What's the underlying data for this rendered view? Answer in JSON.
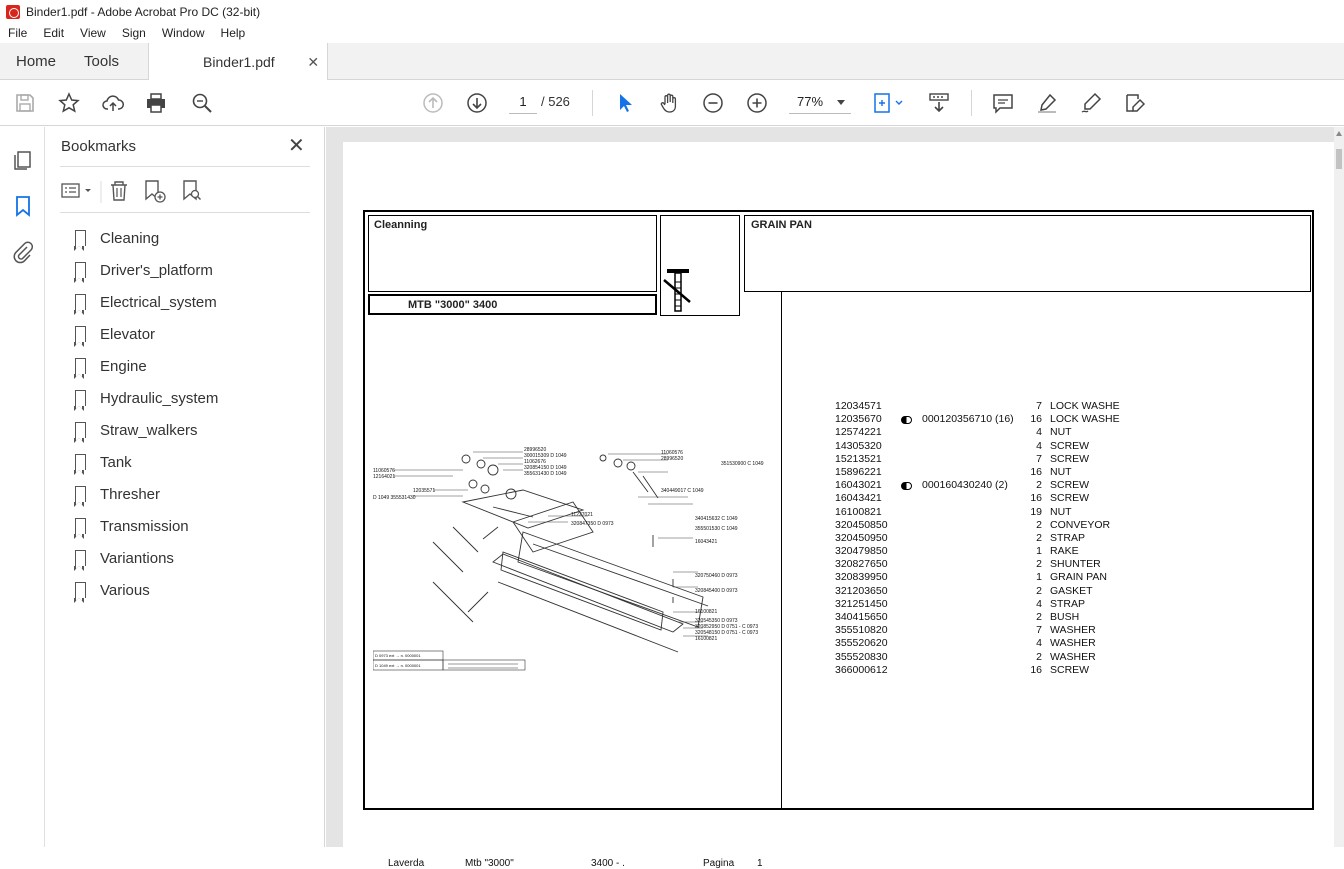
{
  "window": {
    "title": "Binder1.pdf - Adobe Acrobat Pro DC (32-bit)"
  },
  "menu": [
    "File",
    "Edit",
    "View",
    "Sign",
    "Window",
    "Help"
  ],
  "tabs": {
    "home": "Home",
    "tools": "Tools",
    "doc": "Binder1.pdf"
  },
  "toolbar": {
    "page_current": "1",
    "page_total": "/ 526",
    "zoom": "77%"
  },
  "bookmarks": {
    "title": "Bookmarks",
    "items": [
      "Cleaning",
      "Driver's_platform",
      "Electrical_system",
      "Elevator",
      "Engine",
      "Hydraulic_system",
      "Straw_walkers",
      "Tank",
      "Thresher",
      "Transmission",
      "Variantions",
      "Various"
    ]
  },
  "document": {
    "section": "Cleanning",
    "model": "MTB \"3000\" 3400",
    "group": "GRAIN PAN",
    "parts": [
      {
        "pn": "12034571",
        "ref": "",
        "qty": "7",
        "desc": "LOCK WASHE"
      },
      {
        "pn": "12035670",
        "ref": "000120356710 (16)",
        "qty": "16",
        "desc": "LOCK WASHE"
      },
      {
        "pn": "12574221",
        "ref": "",
        "qty": "4",
        "desc": "NUT"
      },
      {
        "pn": "14305320",
        "ref": "",
        "qty": "4",
        "desc": "SCREW"
      },
      {
        "pn": "15213521",
        "ref": "",
        "qty": "7",
        "desc": "SCREW"
      },
      {
        "pn": "15896221",
        "ref": "",
        "qty": "16",
        "desc": "NUT"
      },
      {
        "pn": "16043021",
        "ref": "000160430240 (2)",
        "qty": "2",
        "desc": "SCREW"
      },
      {
        "pn": "16043421",
        "ref": "",
        "qty": "16",
        "desc": "SCREW"
      },
      {
        "pn": "16100821",
        "ref": "",
        "qty": "19",
        "desc": "NUT"
      },
      {
        "pn": "320450850",
        "ref": "",
        "qty": "2",
        "desc": "CONVEYOR"
      },
      {
        "pn": "320450950",
        "ref": "",
        "qty": "2",
        "desc": "STRAP"
      },
      {
        "pn": "320479850",
        "ref": "",
        "qty": "1",
        "desc": "RAKE"
      },
      {
        "pn": "320827650",
        "ref": "",
        "qty": "2",
        "desc": "SHUNTER"
      },
      {
        "pn": "320839950",
        "ref": "",
        "qty": "1",
        "desc": "GRAIN PAN"
      },
      {
        "pn": "321203650",
        "ref": "",
        "qty": "2",
        "desc": "GASKET"
      },
      {
        "pn": "321251450",
        "ref": "",
        "qty": "4",
        "desc": "STRAP"
      },
      {
        "pn": "340415650",
        "ref": "",
        "qty": "2",
        "desc": "BUSH"
      },
      {
        "pn": "355510820",
        "ref": "",
        "qty": "7",
        "desc": "WASHER"
      },
      {
        "pn": "355520620",
        "ref": "",
        "qty": "4",
        "desc": "WASHER"
      },
      {
        "pn": "355520830",
        "ref": "",
        "qty": "2",
        "desc": "WASHER"
      },
      {
        "pn": "366000612",
        "ref": "",
        "qty": "16",
        "desc": "SCREW"
      }
    ],
    "diagram_labels": [
      "28996520",
      "300015309 D 1049",
      "11062676",
      "320854150 D 1049",
      "355631430 D 1049",
      "11060576",
      "12164021",
      "12035571",
      "D 1049 355531430",
      "11060576",
      "28996520",
      "351530900 C 1049",
      "340449017 C 1049",
      "11227021",
      "320847350 D 0973",
      "340415632 C 1049",
      "355501530 C 1049",
      "16043421",
      "320750460 D 0973",
      "320845400 D 0973",
      "16100821",
      "320545350 D 0973",
      "320852950 D 0751 - C 0973",
      "320548150 D 0751 - C 0973",
      "16100821"
    ],
    "footer": {
      "brand": "Laverda",
      "model": "Mtb \"3000\"",
      "code": "3400 - .",
      "page_label": "Pagina",
      "page_num": "1"
    }
  },
  "colors": {
    "accent": "#1473e6",
    "pdf_red": "#d9261c"
  }
}
